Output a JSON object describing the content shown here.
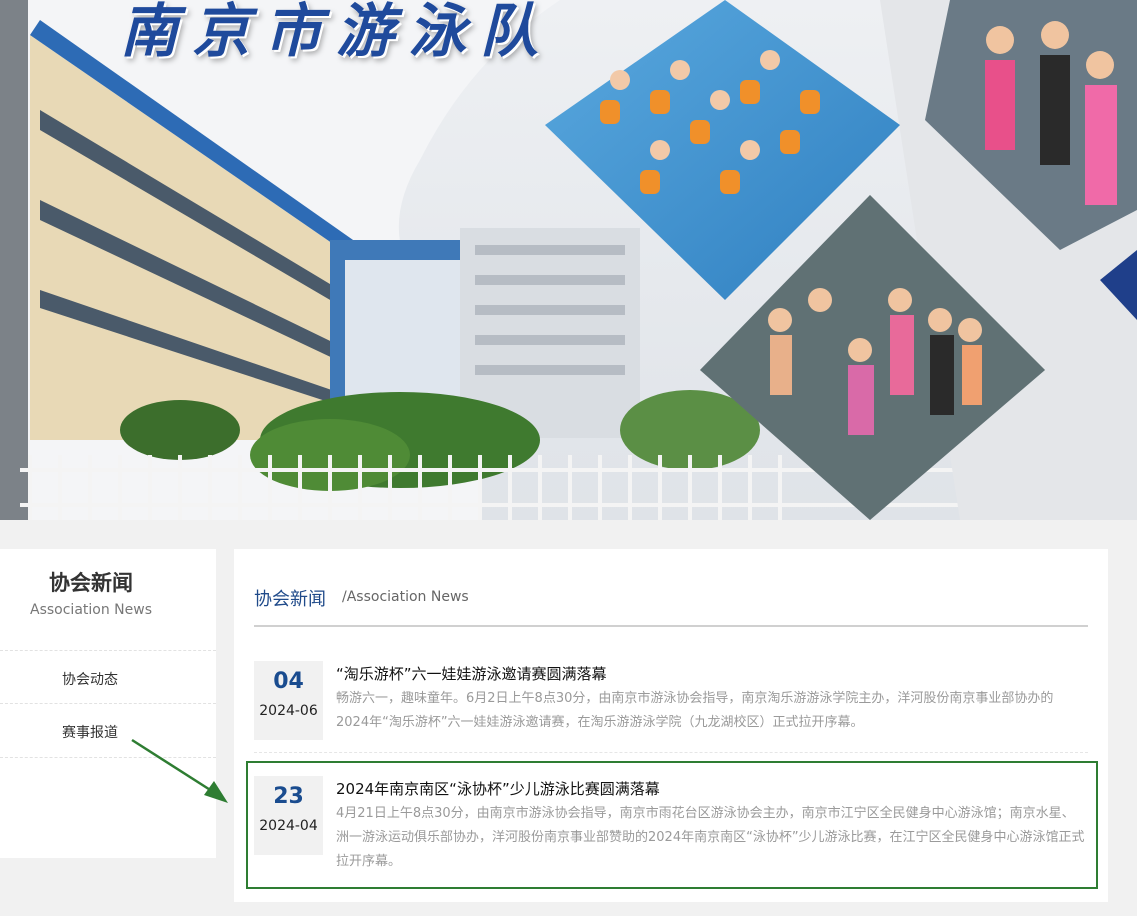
{
  "hero": {
    "title": "南京市游泳队"
  },
  "sidebar": {
    "title": "协会新闻",
    "subtitle": "Association News",
    "items": [
      {
        "label": "协会动态"
      },
      {
        "label": "赛事报道"
      }
    ]
  },
  "main": {
    "title": "协会新闻",
    "subtitle": "/Association News",
    "news": [
      {
        "day": "04",
        "year_month": "2024-06",
        "title": "“淘乐游杯”六一娃娃游泳邀请赛圆满落幕",
        "summary": "畅游六一，趣味童年。6月2日上午8点30分，由南京市游泳协会指导，南京淘乐游游泳学院主办，洋河股份南京事业部协办的2024年“淘乐游杯”六一娃娃游泳邀请赛，在淘乐游游泳学院（九龙湖校区）正式拉开序幕。"
      },
      {
        "day": "23",
        "year_month": "2024-04",
        "title": "2024年南京南区“泳协杯”少儿游泳比赛圆满落幕",
        "summary": "4月21日上午8点30分，由南京市游泳协会指导，南京市雨花台区游泳协会主办，南京市江宁区全民健身中心游泳馆；南京水星、洲一游泳运动俱乐部协办，洋河股份南京事业部赞助的2024年南京南区“泳协杯”少儿游泳比赛，在江宁区全民健身中心游泳馆正式拉开序幕。"
      }
    ]
  },
  "colors": {
    "accent_blue": "#1f4a8a",
    "highlight_green": "#2e7d32"
  }
}
